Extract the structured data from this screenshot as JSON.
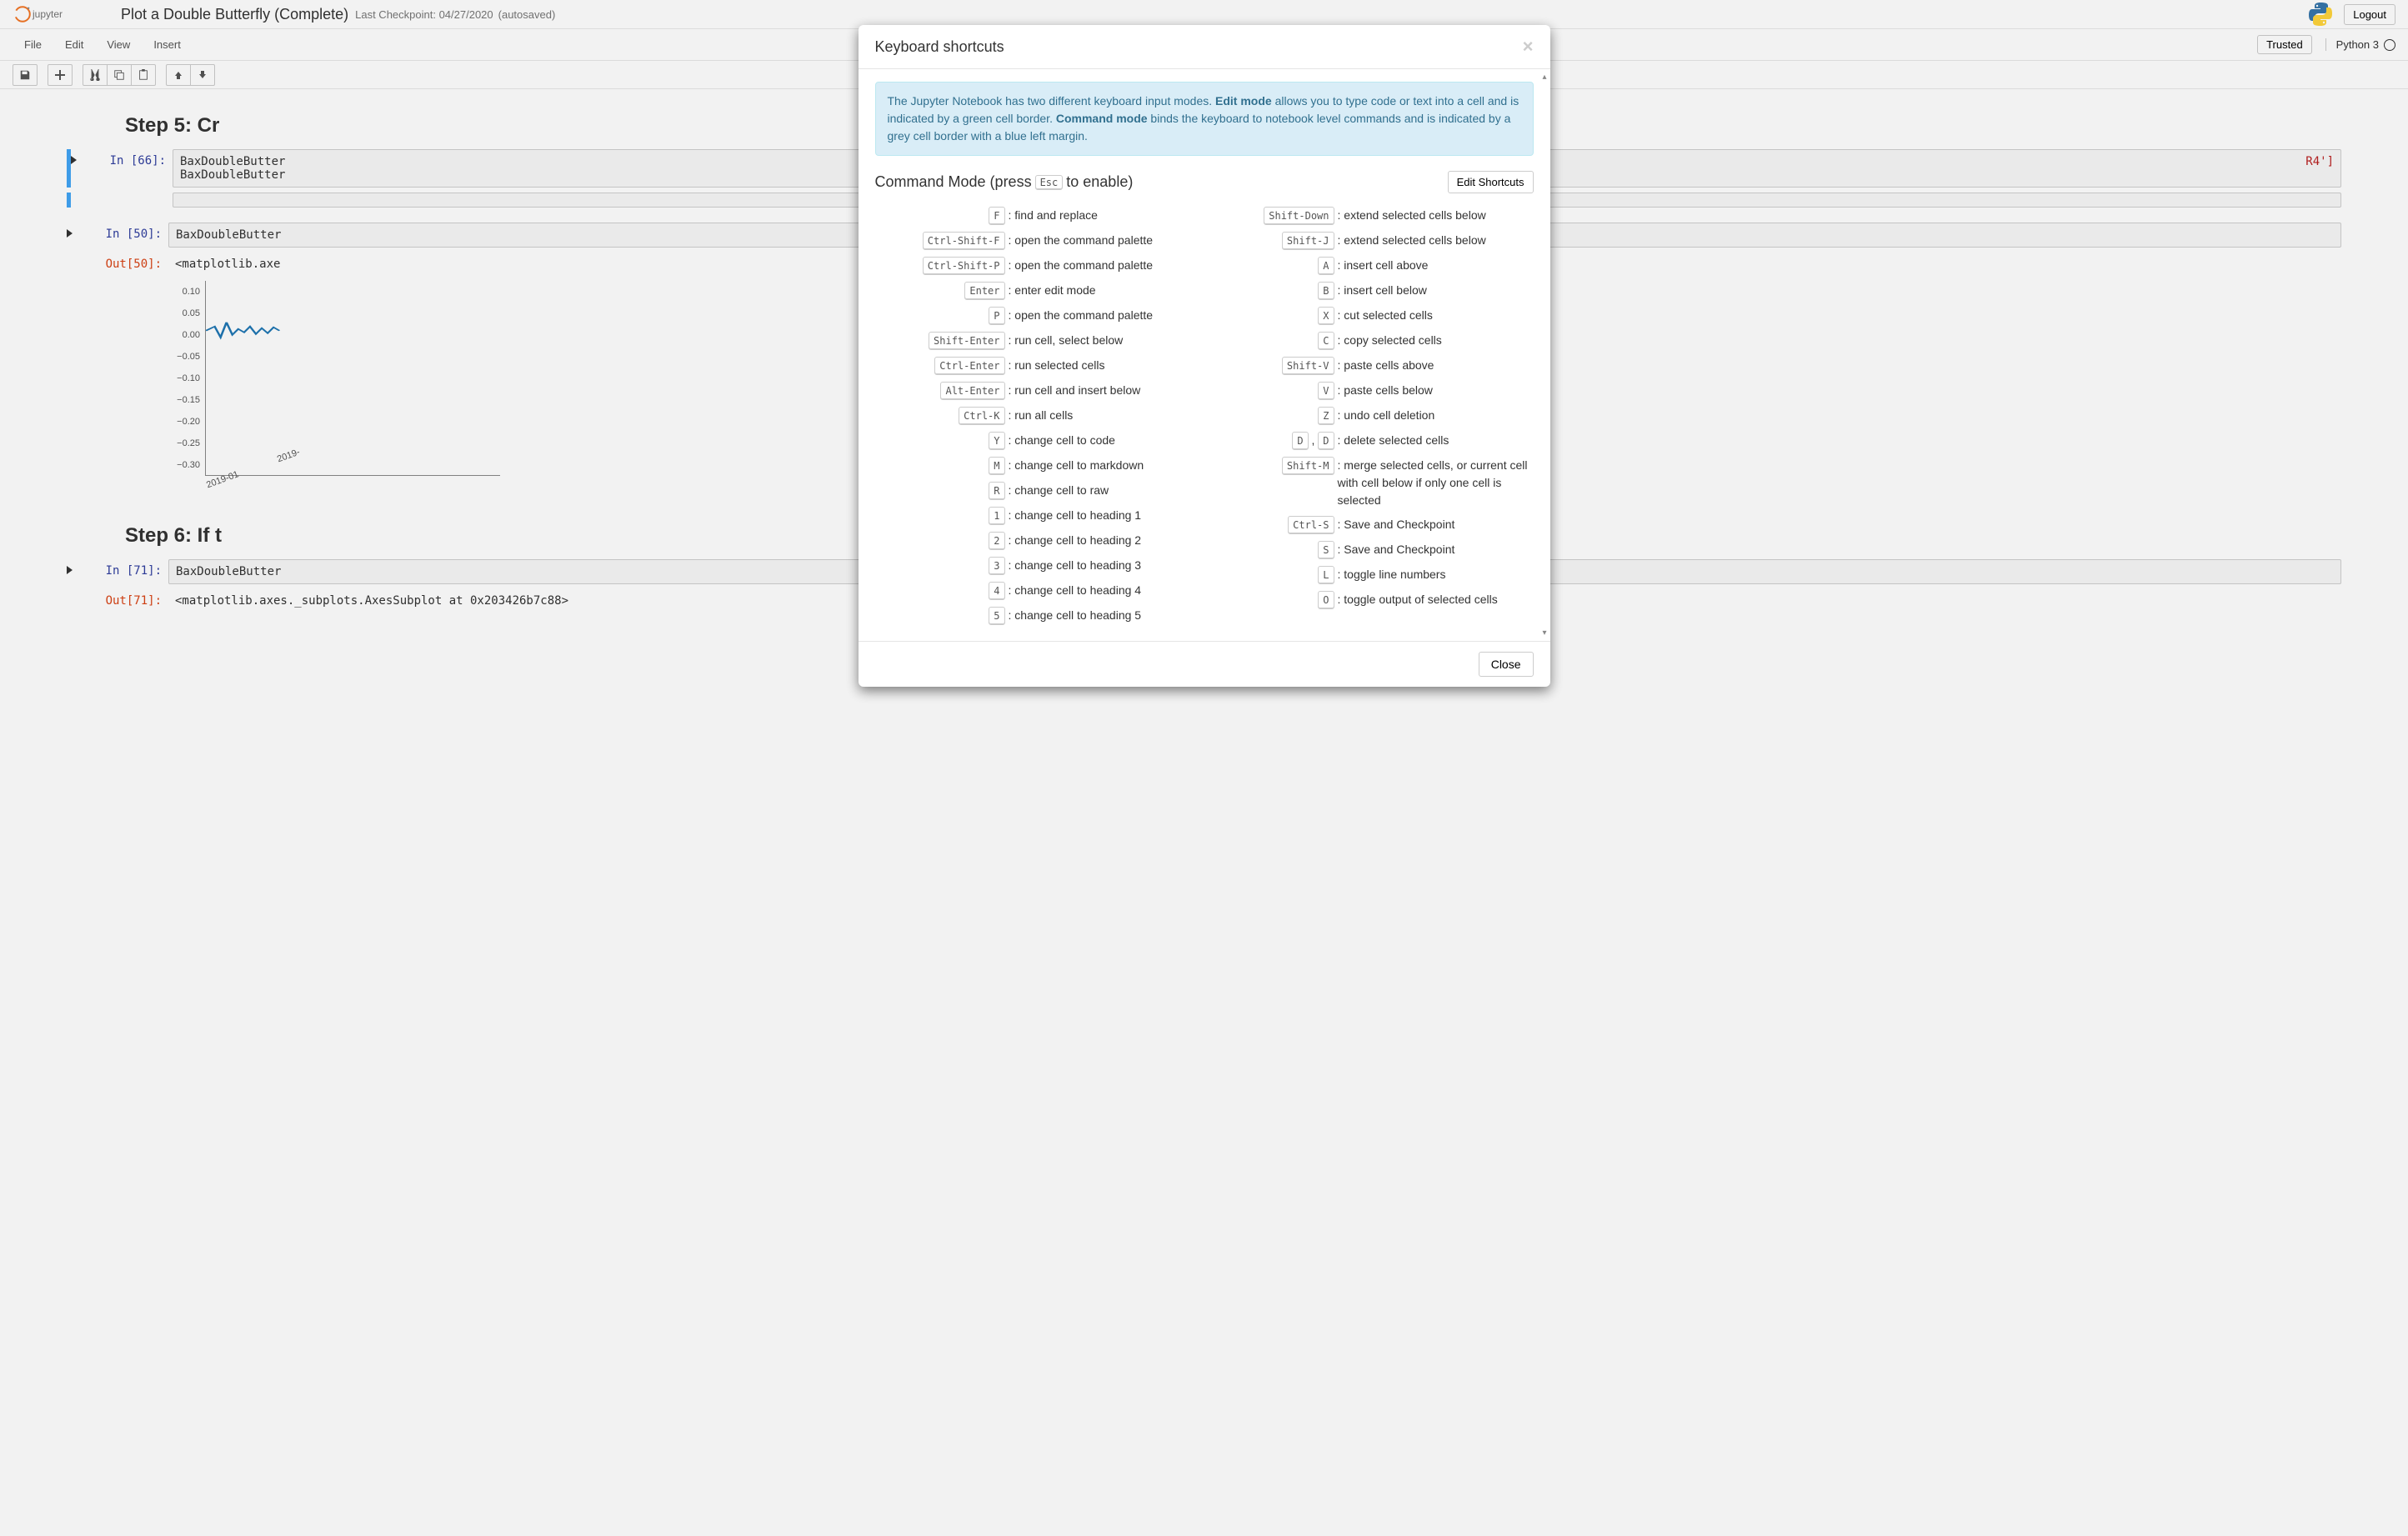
{
  "header": {
    "notebook_name": "Plot a Double Butterfly (Complete)",
    "checkpoint": "Last Checkpoint: 04/27/2020",
    "autosaved": "(autosaved)",
    "logout": "Logout"
  },
  "menubar": {
    "items": [
      "File",
      "Edit",
      "View",
      "Insert"
    ],
    "trusted": "Trusted",
    "kernel": "Python 3"
  },
  "notebook": {
    "heading5": "Step 5: Cr",
    "heading6": "Step 6: If t",
    "cell66_prompt": "In [66]:",
    "cell66_code": "BaxDoubleButter\nBaxDoubleButter",
    "cell66_code_tail": "R4']",
    "cell50_prompt": "In [50]:",
    "cell50_code": "BaxDoubleButter",
    "cell50_out_prompt": "Out[50]:",
    "cell50_out": "<matplotlib.axe",
    "cell71_prompt": "In [71]:",
    "cell71_code": "BaxDoubleButter",
    "cell71_out_prompt": "Out[71]:",
    "cell71_out": "<matplotlib.axes._subplots.AxesSubplot at 0x203426b7c88>"
  },
  "chart_data": {
    "type": "line",
    "yticks": [
      "0.10",
      "0.05",
      "0.00",
      "−0.05",
      "−0.10",
      "−0.15",
      "−0.20",
      "−0.25",
      "−0.30"
    ],
    "xticks": [
      "2019-01",
      "2019-"
    ],
    "ylim": [
      -0.3,
      0.1
    ],
    "note": "partially visible blue noisy line near y≈0"
  },
  "modal": {
    "title": "Keyboard shortcuts",
    "info_pre": "The Jupyter Notebook has two different keyboard input modes. ",
    "info_edit": "Edit mode",
    "info_mid": " allows you to type code or text into a cell and is indicated by a green cell border. ",
    "info_cmd": "Command mode",
    "info_post": " binds the keyboard to notebook level commands and is indicated by a grey cell border with a blue left margin.",
    "cmd_heading_pre": "Command Mode (press ",
    "cmd_heading_key": "Esc",
    "cmd_heading_post": " to enable)",
    "edit_shortcuts_btn": "Edit Shortcuts",
    "close_btn": "Close",
    "left": [
      {
        "keys": [
          "F"
        ],
        "desc": "find and replace"
      },
      {
        "keys": [
          "Ctrl-Shift-F"
        ],
        "desc": "open the command palette"
      },
      {
        "keys": [
          "Ctrl-Shift-P"
        ],
        "desc": "open the command palette"
      },
      {
        "keys": [
          "Enter"
        ],
        "desc": "enter edit mode"
      },
      {
        "keys": [
          "P"
        ],
        "desc": "open the command palette"
      },
      {
        "keys": [
          "Shift-Enter"
        ],
        "desc": "run cell, select below"
      },
      {
        "keys": [
          "Ctrl-Enter"
        ],
        "desc": "run selected cells"
      },
      {
        "keys": [
          "Alt-Enter"
        ],
        "desc": "run cell and insert below"
      },
      {
        "keys": [
          "Ctrl-K"
        ],
        "desc": "run all cells"
      },
      {
        "keys": [
          "Y"
        ],
        "desc": "change cell to code"
      },
      {
        "keys": [
          "M"
        ],
        "desc": "change cell to markdown"
      },
      {
        "keys": [
          "R"
        ],
        "desc": "change cell to raw"
      },
      {
        "keys": [
          "1"
        ],
        "desc": "change cell to heading 1"
      },
      {
        "keys": [
          "2"
        ],
        "desc": "change cell to heading 2"
      },
      {
        "keys": [
          "3"
        ],
        "desc": "change cell to heading 3"
      },
      {
        "keys": [
          "4"
        ],
        "desc": "change cell to heading 4"
      },
      {
        "keys": [
          "5"
        ],
        "desc": "change cell to heading 5"
      }
    ],
    "right": [
      {
        "keys": [
          "Shift-Down"
        ],
        "desc": "extend selected cells below"
      },
      {
        "keys": [
          "Shift-J"
        ],
        "desc": "extend selected cells below"
      },
      {
        "keys": [
          "A"
        ],
        "desc": "insert cell above"
      },
      {
        "keys": [
          "B"
        ],
        "desc": "insert cell below"
      },
      {
        "keys": [
          "X"
        ],
        "desc": "cut selected cells"
      },
      {
        "keys": [
          "C"
        ],
        "desc": "copy selected cells"
      },
      {
        "keys": [
          "Shift-V"
        ],
        "desc": "paste cells above"
      },
      {
        "keys": [
          "V"
        ],
        "desc": "paste cells below"
      },
      {
        "keys": [
          "Z"
        ],
        "desc": "undo cell deletion"
      },
      {
        "keys": [
          "D",
          "D"
        ],
        "desc": "delete selected cells"
      },
      {
        "keys": [
          "Shift-M"
        ],
        "desc": "merge selected cells, or current cell with cell below if only one cell is selected"
      },
      {
        "keys": [
          "Ctrl-S"
        ],
        "desc": "Save and Checkpoint"
      },
      {
        "keys": [
          "S"
        ],
        "desc": "Save and Checkpoint"
      },
      {
        "keys": [
          "L"
        ],
        "desc": "toggle line numbers"
      },
      {
        "keys": [
          "O"
        ],
        "desc": "toggle output of selected cells"
      }
    ]
  }
}
